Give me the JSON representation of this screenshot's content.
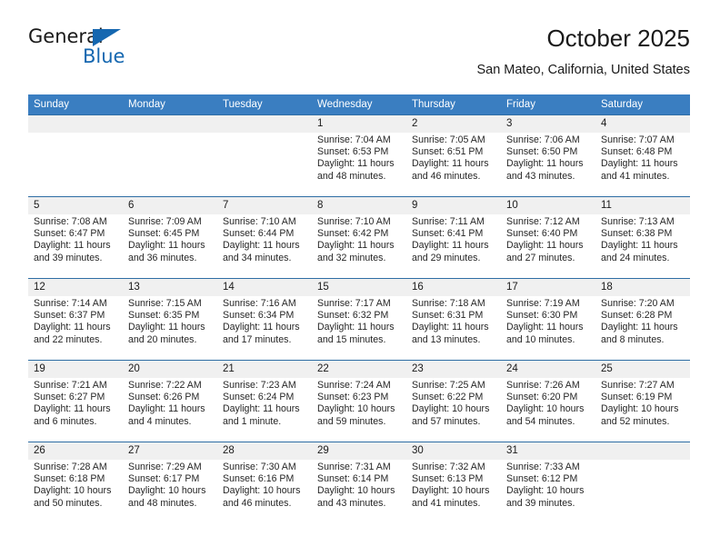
{
  "brand": {
    "name_top": "General",
    "name_bottom": "Blue",
    "accent_color": "#1567b0"
  },
  "header": {
    "title": "October 2025",
    "subtitle": "San Mateo, California, United States"
  },
  "theme": {
    "header_bg": "#3a7ec1",
    "header_text": "#ffffff",
    "daynum_bg": "#f0f0f0",
    "cell_border": "#2e6da4",
    "text": "#1a1a1a"
  },
  "calendar": {
    "weekday_headers": [
      "Sunday",
      "Monday",
      "Tuesday",
      "Wednesday",
      "Thursday",
      "Friday",
      "Saturday"
    ],
    "weeks": [
      [
        {
          "day": "",
          "empty": true
        },
        {
          "day": "",
          "empty": true
        },
        {
          "day": "",
          "empty": true
        },
        {
          "day": "1",
          "sunrise": "Sunrise: 7:04 AM",
          "sunset": "Sunset: 6:53 PM",
          "daylight": "Daylight: 11 hours and 48 minutes."
        },
        {
          "day": "2",
          "sunrise": "Sunrise: 7:05 AM",
          "sunset": "Sunset: 6:51 PM",
          "daylight": "Daylight: 11 hours and 46 minutes."
        },
        {
          "day": "3",
          "sunrise": "Sunrise: 7:06 AM",
          "sunset": "Sunset: 6:50 PM",
          "daylight": "Daylight: 11 hours and 43 minutes."
        },
        {
          "day": "4",
          "sunrise": "Sunrise: 7:07 AM",
          "sunset": "Sunset: 6:48 PM",
          "daylight": "Daylight: 11 hours and 41 minutes."
        }
      ],
      [
        {
          "day": "5",
          "sunrise": "Sunrise: 7:08 AM",
          "sunset": "Sunset: 6:47 PM",
          "daylight": "Daylight: 11 hours and 39 minutes."
        },
        {
          "day": "6",
          "sunrise": "Sunrise: 7:09 AM",
          "sunset": "Sunset: 6:45 PM",
          "daylight": "Daylight: 11 hours and 36 minutes."
        },
        {
          "day": "7",
          "sunrise": "Sunrise: 7:10 AM",
          "sunset": "Sunset: 6:44 PM",
          "daylight": "Daylight: 11 hours and 34 minutes."
        },
        {
          "day": "8",
          "sunrise": "Sunrise: 7:10 AM",
          "sunset": "Sunset: 6:42 PM",
          "daylight": "Daylight: 11 hours and 32 minutes."
        },
        {
          "day": "9",
          "sunrise": "Sunrise: 7:11 AM",
          "sunset": "Sunset: 6:41 PM",
          "daylight": "Daylight: 11 hours and 29 minutes."
        },
        {
          "day": "10",
          "sunrise": "Sunrise: 7:12 AM",
          "sunset": "Sunset: 6:40 PM",
          "daylight": "Daylight: 11 hours and 27 minutes."
        },
        {
          "day": "11",
          "sunrise": "Sunrise: 7:13 AM",
          "sunset": "Sunset: 6:38 PM",
          "daylight": "Daylight: 11 hours and 24 minutes."
        }
      ],
      [
        {
          "day": "12",
          "sunrise": "Sunrise: 7:14 AM",
          "sunset": "Sunset: 6:37 PM",
          "daylight": "Daylight: 11 hours and 22 minutes."
        },
        {
          "day": "13",
          "sunrise": "Sunrise: 7:15 AM",
          "sunset": "Sunset: 6:35 PM",
          "daylight": "Daylight: 11 hours and 20 minutes."
        },
        {
          "day": "14",
          "sunrise": "Sunrise: 7:16 AM",
          "sunset": "Sunset: 6:34 PM",
          "daylight": "Daylight: 11 hours and 17 minutes."
        },
        {
          "day": "15",
          "sunrise": "Sunrise: 7:17 AM",
          "sunset": "Sunset: 6:32 PM",
          "daylight": "Daylight: 11 hours and 15 minutes."
        },
        {
          "day": "16",
          "sunrise": "Sunrise: 7:18 AM",
          "sunset": "Sunset: 6:31 PM",
          "daylight": "Daylight: 11 hours and 13 minutes."
        },
        {
          "day": "17",
          "sunrise": "Sunrise: 7:19 AM",
          "sunset": "Sunset: 6:30 PM",
          "daylight": "Daylight: 11 hours and 10 minutes."
        },
        {
          "day": "18",
          "sunrise": "Sunrise: 7:20 AM",
          "sunset": "Sunset: 6:28 PM",
          "daylight": "Daylight: 11 hours and 8 minutes."
        }
      ],
      [
        {
          "day": "19",
          "sunrise": "Sunrise: 7:21 AM",
          "sunset": "Sunset: 6:27 PM",
          "daylight": "Daylight: 11 hours and 6 minutes."
        },
        {
          "day": "20",
          "sunrise": "Sunrise: 7:22 AM",
          "sunset": "Sunset: 6:26 PM",
          "daylight": "Daylight: 11 hours and 4 minutes."
        },
        {
          "day": "21",
          "sunrise": "Sunrise: 7:23 AM",
          "sunset": "Sunset: 6:24 PM",
          "daylight": "Daylight: 11 hours and 1 minute."
        },
        {
          "day": "22",
          "sunrise": "Sunrise: 7:24 AM",
          "sunset": "Sunset: 6:23 PM",
          "daylight": "Daylight: 10 hours and 59 minutes."
        },
        {
          "day": "23",
          "sunrise": "Sunrise: 7:25 AM",
          "sunset": "Sunset: 6:22 PM",
          "daylight": "Daylight: 10 hours and 57 minutes."
        },
        {
          "day": "24",
          "sunrise": "Sunrise: 7:26 AM",
          "sunset": "Sunset: 6:20 PM",
          "daylight": "Daylight: 10 hours and 54 minutes."
        },
        {
          "day": "25",
          "sunrise": "Sunrise: 7:27 AM",
          "sunset": "Sunset: 6:19 PM",
          "daylight": "Daylight: 10 hours and 52 minutes."
        }
      ],
      [
        {
          "day": "26",
          "sunrise": "Sunrise: 7:28 AM",
          "sunset": "Sunset: 6:18 PM",
          "daylight": "Daylight: 10 hours and 50 minutes."
        },
        {
          "day": "27",
          "sunrise": "Sunrise: 7:29 AM",
          "sunset": "Sunset: 6:17 PM",
          "daylight": "Daylight: 10 hours and 48 minutes."
        },
        {
          "day": "28",
          "sunrise": "Sunrise: 7:30 AM",
          "sunset": "Sunset: 6:16 PM",
          "daylight": "Daylight: 10 hours and 46 minutes."
        },
        {
          "day": "29",
          "sunrise": "Sunrise: 7:31 AM",
          "sunset": "Sunset: 6:14 PM",
          "daylight": "Daylight: 10 hours and 43 minutes."
        },
        {
          "day": "30",
          "sunrise": "Sunrise: 7:32 AM",
          "sunset": "Sunset: 6:13 PM",
          "daylight": "Daylight: 10 hours and 41 minutes."
        },
        {
          "day": "31",
          "sunrise": "Sunrise: 7:33 AM",
          "sunset": "Sunset: 6:12 PM",
          "daylight": "Daylight: 10 hours and 39 minutes."
        },
        {
          "day": "",
          "empty": true
        }
      ]
    ]
  }
}
